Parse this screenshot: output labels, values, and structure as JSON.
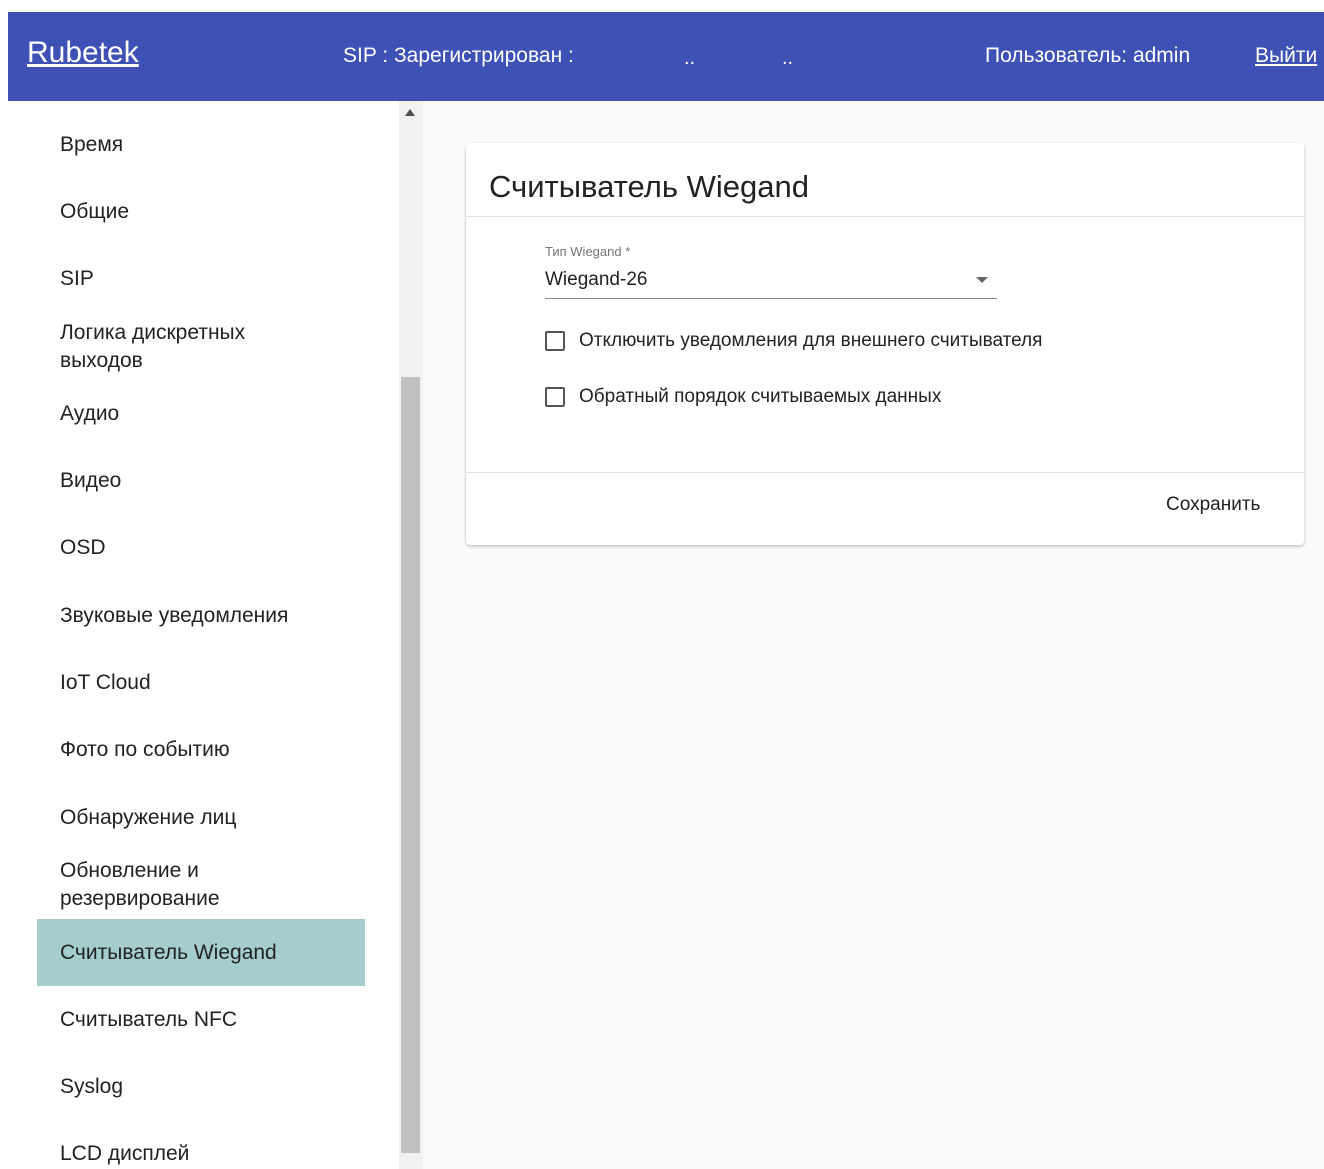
{
  "header": {
    "brand": "Rubetek",
    "sip_status": "SIP : Зарегистрирован :",
    "dots_1": "..",
    "dots_2": "..",
    "user_label": "Пользователь: admin",
    "logout": "Выйти"
  },
  "sidebar": {
    "items": [
      {
        "label": "Время"
      },
      {
        "label": "Общие"
      },
      {
        "label": "SIP"
      },
      {
        "label": "Логика дискретных выходов"
      },
      {
        "label": "Аудио"
      },
      {
        "label": "Видео"
      },
      {
        "label": "OSD"
      },
      {
        "label": "Звуковые уведомления"
      },
      {
        "label": "IoT Cloud"
      },
      {
        "label": "Фото по событию"
      },
      {
        "label": "Обнаружение лиц"
      },
      {
        "label": "Обновление и резервирование"
      },
      {
        "label": "Считыватель Wiegand"
      },
      {
        "label": "Считыватель NFC"
      },
      {
        "label": "Syslog"
      },
      {
        "label": "LCD дисплей"
      }
    ],
    "active_item": "Считыватель Wiegand"
  },
  "card": {
    "title": "Считыватель Wiegand",
    "wiegand_type": {
      "label": "Тип Wiegand *",
      "value": "Wiegand-26"
    },
    "checkboxes": [
      {
        "label": "Отключить уведомления для внешнего считывателя",
        "checked": false
      },
      {
        "label": "Обратный порядок считываемых данных",
        "checked": false
      }
    ],
    "save_label": "Сохранить"
  },
  "colors": {
    "header_bg": "#3f51b5",
    "active_item_bg": "#a5cdcd",
    "main_bg": "#fafafa"
  }
}
